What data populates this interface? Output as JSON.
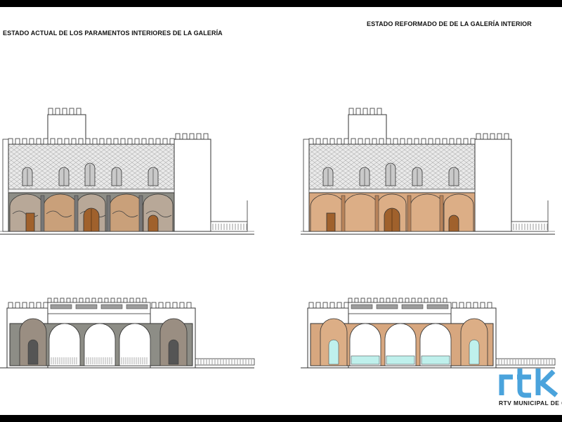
{
  "titles": {
    "left": "ESTADO ACTUAL DE LOS PARAMENTOS INTERIORES DE LA GALERÍA",
    "right": "ESTADO REFORMADO DE DE LA GALERÍA INTERIOR"
  },
  "logo": {
    "mark": "rtv",
    "caption": "RTV MUNICIPAL DE CH"
  },
  "colors": {
    "line": "#333333",
    "tile_fill": "#eaeaea",
    "tile_stroke": "#9a9a9a",
    "ochre": "#d7a77f",
    "ochre_dark": "#b8835a",
    "door": "#a0612c",
    "mural_grey": "#8d8d86",
    "glass": "#bff0ec",
    "logo_blue": "#4aa3dc"
  },
  "icons": [
    "crenellated-tower-icon",
    "tiled-wall-icon",
    "arched-window-icon",
    "arch-door-icon"
  ]
}
